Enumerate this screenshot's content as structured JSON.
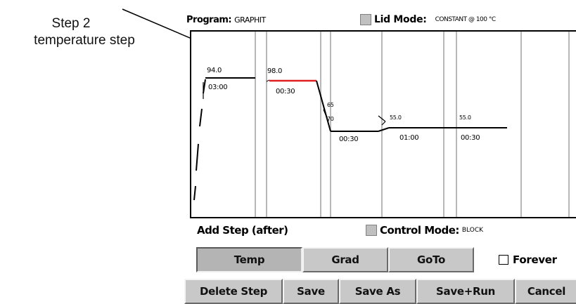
{
  "annotation": {
    "line1": "Step 2",
    "line2": "temperature step"
  },
  "header": {
    "program_label": "Program:",
    "program_name": "GRAPHIT",
    "lid_mode_label": "Lid Mode:",
    "lid_mode_value": "CONSTANT @ 100 °C"
  },
  "graph": {
    "steps": [
      {
        "temp": "94.0",
        "time": "03:00"
      },
      {
        "temp": "98.0",
        "time": "00:30"
      },
      {
        "temp": "70",
        "time": "00:30",
        "ramp_label": "65"
      },
      {
        "temp": "55.0",
        "time": "01:00"
      },
      {
        "temp": "55.0",
        "time": "00:30"
      }
    ],
    "selected_step": 2,
    "colors": {
      "trace": "#000000",
      "selected": "#e02020",
      "divider": "#b8b8b8"
    }
  },
  "add_step": {
    "label": "Add Step (after)"
  },
  "control_mode": {
    "label": "Control Mode:",
    "value": "BLOCK"
  },
  "step_type_buttons": {
    "temp": "Temp",
    "grad": "Grad",
    "goto": "GoTo"
  },
  "forever": {
    "label": "Forever",
    "checked": false
  },
  "actions": {
    "delete_step": "Delete Step",
    "save": "Save",
    "save_as": "Save As",
    "save_run": "Save+Run",
    "cancel": "Cancel"
  }
}
